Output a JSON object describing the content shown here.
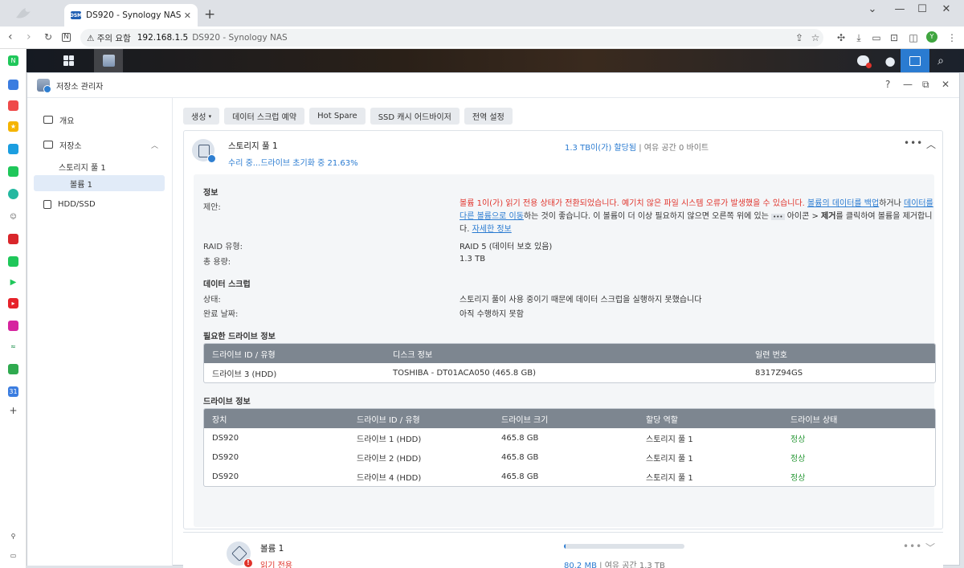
{
  "browser": {
    "tab_title": "DS920 - Synology NAS",
    "tab_icon_text": "DSM",
    "address_warning": "주의 요함",
    "address_host": "192.168.1.5",
    "address_path": "DS920 - Synology NAS",
    "profile_initial": "Y"
  },
  "window": {
    "title": "저장소 관리자"
  },
  "sidebar": {
    "overview": "개요",
    "storage": "저장소",
    "storage_pool": "스토리지 풀 1",
    "volume": "볼륨 1",
    "hdd_ssd": "HDD/SSD"
  },
  "toolbar": {
    "create": "생성",
    "scrub_schedule": "데이터 스크럽 예약",
    "hot_spare": "Hot Spare",
    "ssd_cache_advisor": "SSD 캐시 어드바이저",
    "global_settings": "전역 설정"
  },
  "pool": {
    "name": "스토리지 풀 1",
    "status": "수리 중...드라이브 초기화 중 21.63%",
    "allocated": "1.3 TB이(가) 할당됨",
    "separator": "|",
    "free": "여유 공간 0 바이트"
  },
  "info": {
    "section_title": "정보",
    "advice_label": "제안:",
    "advice_red": "볼륨 1이(가) 읽기 전용 상태가 전환되었습니다. 예기치 않은 파일 시스템 오류가 발생했을 수 있습니다.",
    "advice_link1": "볼륨의 데이터를 백업",
    "advice_t1": "하거나",
    "advice_link2": "데이터를 다른 볼륨으로 이동",
    "advice_t2": "하는 것이 좋습니다. 이 볼륨이 더 이상 필요하지 않으면 오른쪽 위에 있는",
    "advice_dots": "•••",
    "advice_t3": "아이콘 >",
    "advice_bold": "제거",
    "advice_t4": "를 클릭하여 볼륨을 제거합니다.",
    "advice_link3": "자세한 정보",
    "raid_label": "RAID 유형:",
    "raid_value": "RAID 5 (데이터 보호 있음)",
    "capacity_label": "총 용량:",
    "capacity_value": "1.3 TB"
  },
  "scrub": {
    "section_title": "데이터 스크럽",
    "status_label": "상태:",
    "status_value": "스토리지 풀이 사용 중이기 때문에 데이터 스크럽을 실행하지 못했습니다",
    "completed_label": "완료 날짜:",
    "completed_value": "아직 수행하지 못함"
  },
  "required_drive": {
    "section_title": "필요한 드라이브 정보",
    "headers": [
      "드라이브 ID / 유형",
      "디스크 정보",
      "일련 번호"
    ],
    "row": [
      "드라이브 3 (HDD)",
      "TOSHIBA - DT01ACA050 (465.8 GB)",
      "8317Z94GS"
    ]
  },
  "drive_info": {
    "section_title": "드라이브 정보",
    "headers": [
      "장치",
      "드라이브 ID / 유형",
      "드라이브 크기",
      "할당 역할",
      "드라이브 상태"
    ],
    "rows": [
      [
        "DS920",
        "드라이브 1 (HDD)",
        "465.8 GB",
        "스토리지 풀 1",
        "정상"
      ],
      [
        "DS920",
        "드라이브 2 (HDD)",
        "465.8 GB",
        "스토리지 풀 1",
        "정상"
      ],
      [
        "DS920",
        "드라이브 4 (HDD)",
        "465.8 GB",
        "스토리지 풀 1",
        "정상"
      ]
    ]
  },
  "volume": {
    "name": "볼륨 1",
    "status": "읽기 전용",
    "used": "80.2 MB",
    "separator": "|",
    "free": "여유 공간 1.3 TB",
    "usage_fraction": 0.01
  },
  "colors": {
    "accent": "#2a7bd1",
    "error": "#e0332b",
    "ok": "#2c9a3a",
    "table_header": "#7d8690"
  }
}
